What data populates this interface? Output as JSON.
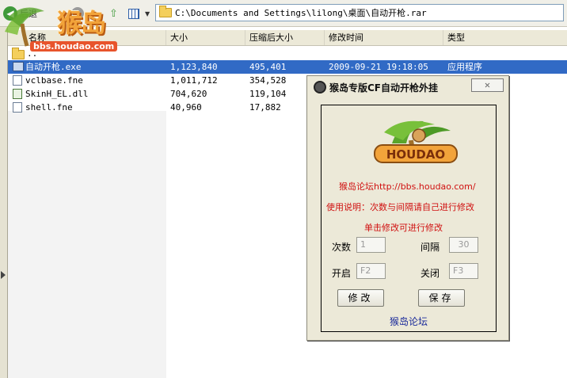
{
  "toolbar": {
    "back_label": "后退",
    "address_path": "C:\\Documents and Settings\\lilong\\桌面\\自动开枪.rar"
  },
  "watermark": {
    "brand_cn": "猴岛",
    "brand_url": "bbs.houdao.com"
  },
  "list": {
    "columns": [
      "名称",
      "大小",
      "压缩后大小",
      "修改时间",
      "类型"
    ],
    "parent_row": "..",
    "rows": [
      {
        "name": "自动开枪.exe",
        "size": "1,123,840",
        "packed": "495,401",
        "modified": "2009-09-21 19:18:05",
        "type": "应用程序",
        "icon": "exe-icon"
      },
      {
        "name": "vclbase.fne",
        "size": "1,011,712",
        "packed": "354,528",
        "modified": "",
        "type": "",
        "icon": "file-icon"
      },
      {
        "name": "SkinH_EL.dll",
        "size": "704,620",
        "packed": "119,104",
        "modified": "",
        "type": "",
        "icon": "dll-icon"
      },
      {
        "name": "shell.fne",
        "size": "40,960",
        "packed": "17,882",
        "modified": "",
        "type": "",
        "icon": "file-icon"
      }
    ]
  },
  "dialog": {
    "title": "猴岛专版CF自动开枪外挂",
    "close_symbol": "✕",
    "logo_text": "HOUDAO",
    "forum_line": "猴岛论坛http://bbs.houdao.com/",
    "usage_line": "使用说明：次数与间隔请自己进行修改",
    "click_line": "单击修改可进行修改",
    "count_label": "次数",
    "count_value": "1",
    "interval_label": "间隔",
    "interval_value": "30",
    "start_label": "开启",
    "start_value": "F2",
    "stop_label": "关闭",
    "stop_value": "F3",
    "modify_button": "修改",
    "save_button": "保存",
    "footer": "猴岛论坛"
  },
  "colors": {
    "selection": "#316ac5",
    "red_text": "#d01010",
    "blue_text": "#1a2a9a"
  }
}
